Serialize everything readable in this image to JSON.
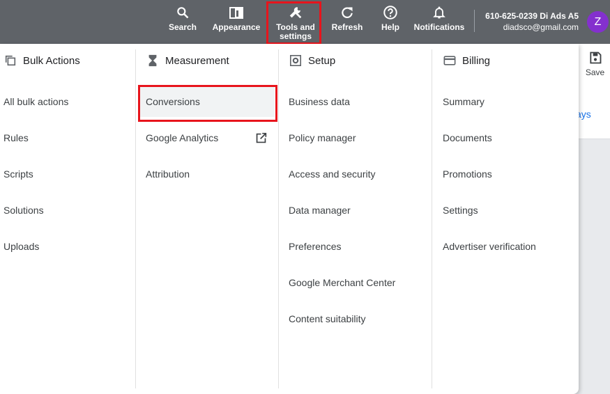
{
  "topbar": {
    "buttons": [
      {
        "label": "Search",
        "icon": "search-icon"
      },
      {
        "label": "Appearance",
        "icon": "appearance-icon"
      },
      {
        "label": "Tools and\nsettings",
        "icon": "wrench-icon"
      },
      {
        "label": "Refresh",
        "icon": "refresh-icon"
      },
      {
        "label": "Help",
        "icon": "help-icon"
      },
      {
        "label": "Notifications",
        "icon": "bell-icon"
      }
    ],
    "account": {
      "name": "610-625-0239 Di Ads A5",
      "email": "diadsco@gmail.com"
    },
    "avatar_letter": "Z"
  },
  "background": {
    "save_label": "Save",
    "partial_link": "ays"
  },
  "menu": {
    "columns": [
      {
        "heading": "Bulk Actions",
        "icon": "bulk-actions-icon",
        "items": [
          "All bulk actions",
          "Rules",
          "Scripts",
          "Solutions",
          "Uploads"
        ]
      },
      {
        "heading": "Measurement",
        "icon": "hourglass-icon",
        "items": [
          "Conversions",
          "Google Analytics",
          "Attribution"
        ]
      },
      {
        "heading": "Setup",
        "icon": "setup-icon",
        "items": [
          "Business data",
          "Policy manager",
          "Access and security",
          "Data manager",
          "Preferences",
          "Google Merchant Center",
          "Content suitability"
        ]
      },
      {
        "heading": "Billing",
        "icon": "billing-icon",
        "items": [
          "Summary",
          "Documents",
          "Promotions",
          "Settings",
          "Advertiser verification"
        ]
      }
    ]
  },
  "colors": {
    "topbar": "#5f6368",
    "highlight": "#e8141c",
    "avatar": "#8430ce",
    "link": "#1a73e8"
  }
}
